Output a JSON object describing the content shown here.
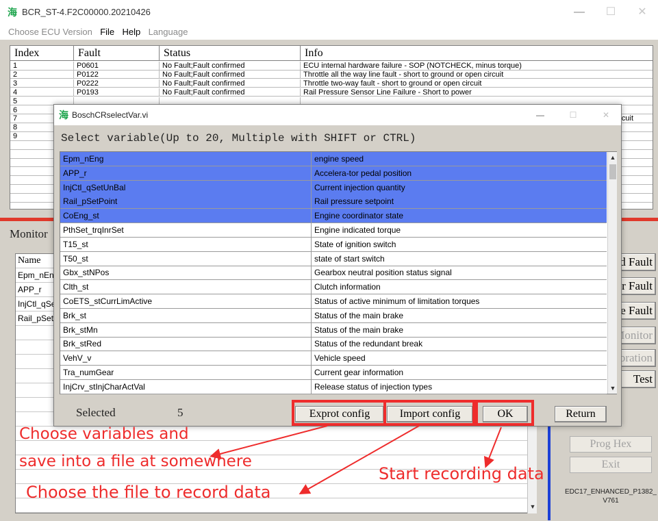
{
  "main_window": {
    "title": "BCR_ST-4.F2C00000.20210426",
    "controls": {
      "minimize": "—",
      "maximize": "☐",
      "close": "✕"
    },
    "menu": [
      {
        "label": "Choose ECU Version",
        "enabled": false
      },
      {
        "label": "File",
        "enabled": true
      },
      {
        "label": "Help",
        "enabled": true
      },
      {
        "label": "Language",
        "enabled": false
      }
    ]
  },
  "fault_table": {
    "headers": [
      "Index",
      "Fault",
      "Status",
      "Info"
    ],
    "rows": [
      {
        "index": "1",
        "fault": "P0601",
        "status": "No Fault;Fault confirmed",
        "info": "ECU internal hardware failure - SOP (NOTCHECK, minus torque)"
      },
      {
        "index": "2",
        "fault": "P0122",
        "status": "No Fault;Fault confirmed",
        "info": "Throttle all the way line fault - short to ground or open circuit"
      },
      {
        "index": "3",
        "fault": "P0222",
        "status": "No Fault;Fault confirmed",
        "info": "Throttle two-way fault - short to ground or open circuit"
      },
      {
        "index": "4",
        "fault": "P0193",
        "status": "No Fault;Fault confirmed",
        "info": "Rail Pressure Sensor Line Failure - Short to power"
      },
      {
        "index": "5",
        "fault": "",
        "status": "",
        "info": ""
      },
      {
        "index": "6",
        "fault": "",
        "status": "",
        "info": ""
      },
      {
        "index": "7",
        "fault": "",
        "status": "",
        "info": "rcuit"
      },
      {
        "index": "8",
        "fault": "",
        "status": "",
        "info": ""
      },
      {
        "index": "9",
        "fault": "",
        "status": "",
        "info": ""
      }
    ]
  },
  "monitor": {
    "label": "Monitor",
    "name_header": "Name",
    "rows": [
      "Epm_nEng",
      "APP_r",
      "InjCtl_qSetUnBal",
      "Rail_pSetPoint"
    ],
    "side_buttons": [
      {
        "label": "Read Fault",
        "enabled": true
      },
      {
        "label": "Clear Fault",
        "enabled": true
      },
      {
        "label": "Freeze Fault",
        "enabled": true
      },
      {
        "label": "Monitor",
        "enabled": false
      },
      {
        "label": "Calibration",
        "enabled": false
      },
      {
        "label": "Test",
        "enabled": true
      }
    ],
    "prog_hex": "Prog Hex",
    "exit": "Exit",
    "version_line1": "EDC17_ENHANCED_P1382_",
    "version_line2": "V761"
  },
  "dialog": {
    "title": "BoschCRselectVar.vi",
    "controls": {
      "minimize": "—",
      "maximize": "☐",
      "close": "✕"
    },
    "prompt": "Select variable(Up to 20, Multiple with SHIFT or CTRL)",
    "variables": [
      {
        "name": "Epm_nEng",
        "desc": "engine speed",
        "selected": true
      },
      {
        "name": "APP_r",
        "desc": "Accelera-tor pedal position",
        "selected": true
      },
      {
        "name": "InjCtl_qSetUnBal",
        "desc": "Current injection quantity",
        "selected": true
      },
      {
        "name": "Rail_pSetPoint",
        "desc": "Rail pressure setpoint",
        "selected": true
      },
      {
        "name": "CoEng_st",
        "desc": "Engine coordinator state",
        "selected": true
      },
      {
        "name": "PthSet_trqInrSet",
        "desc": "Engine indicated torque",
        "selected": false
      },
      {
        "name": "T15_st",
        "desc": "State of ignition switch",
        "selected": false
      },
      {
        "name": "T50_st",
        "desc": "state of start switch",
        "selected": false
      },
      {
        "name": "Gbx_stNPos",
        "desc": "Gearbox neutral position status signal",
        "selected": false
      },
      {
        "name": "Clth_st",
        "desc": "Clutch information",
        "selected": false
      },
      {
        "name": "CoETS_stCurrLimActive",
        "desc": "Status of active minimum of limitation torques",
        "selected": false
      },
      {
        "name": "Brk_st",
        "desc": "Status of the main brake",
        "selected": false
      },
      {
        "name": "Brk_stMn",
        "desc": "Status of the main brake",
        "selected": false
      },
      {
        "name": "Brk_stRed",
        "desc": "Status of the redundant break",
        "selected": false
      },
      {
        "name": "VehV_v",
        "desc": "Vehicle speed",
        "selected": false
      },
      {
        "name": "Tra_numGear",
        "desc": "Current gear information",
        "selected": false
      },
      {
        "name": "InjCrv_stInjCharActVal",
        "desc": "Release status of injection types",
        "selected": false
      }
    ],
    "selected_label": "Selected",
    "selected_count": "5",
    "buttons": {
      "export": "Exprot config",
      "import": "Import config",
      "ok": "OK",
      "return": "Return"
    }
  },
  "annotations": {
    "choose_line1": "Choose variables and",
    "choose_line2": "save into a file at somewhere",
    "choose_file": "Choose the file to record data",
    "start": "Start recording data",
    "color": "#ee2c2c"
  }
}
